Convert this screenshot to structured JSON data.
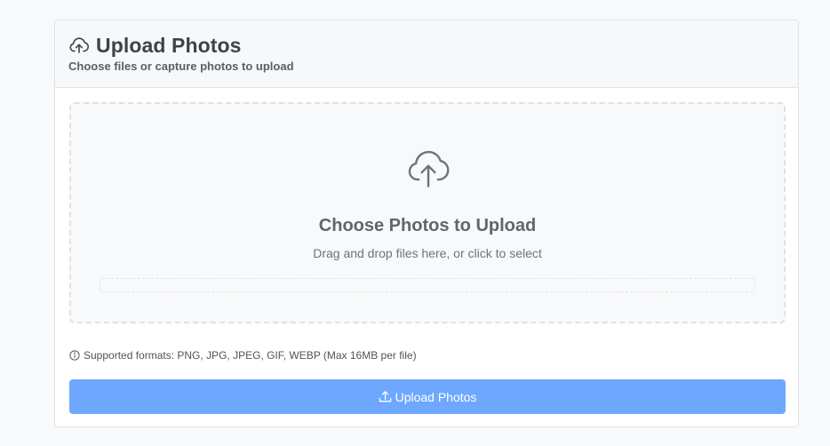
{
  "header": {
    "icon": "cloud-upload-icon",
    "title": "Upload Photos",
    "subtitle": "Choose files or capture photos to upload"
  },
  "dropzone": {
    "icon": "cloud-upload-icon",
    "title": "Choose Photos to Upload",
    "subtitle": "Drag and drop files here, or click to select"
  },
  "formats": {
    "icon": "info-circle-icon",
    "text": "Supported formats: PNG, JPG, JPEG, GIF, WEBP (Max 16MB per file)"
  },
  "upload_button": {
    "icon": "upload-icon",
    "label": "Upload Photos",
    "disabled": true
  },
  "colors": {
    "button_bg": "#6ea8fe",
    "dropzone_border": "#dee2e6",
    "text": "#343a40"
  }
}
